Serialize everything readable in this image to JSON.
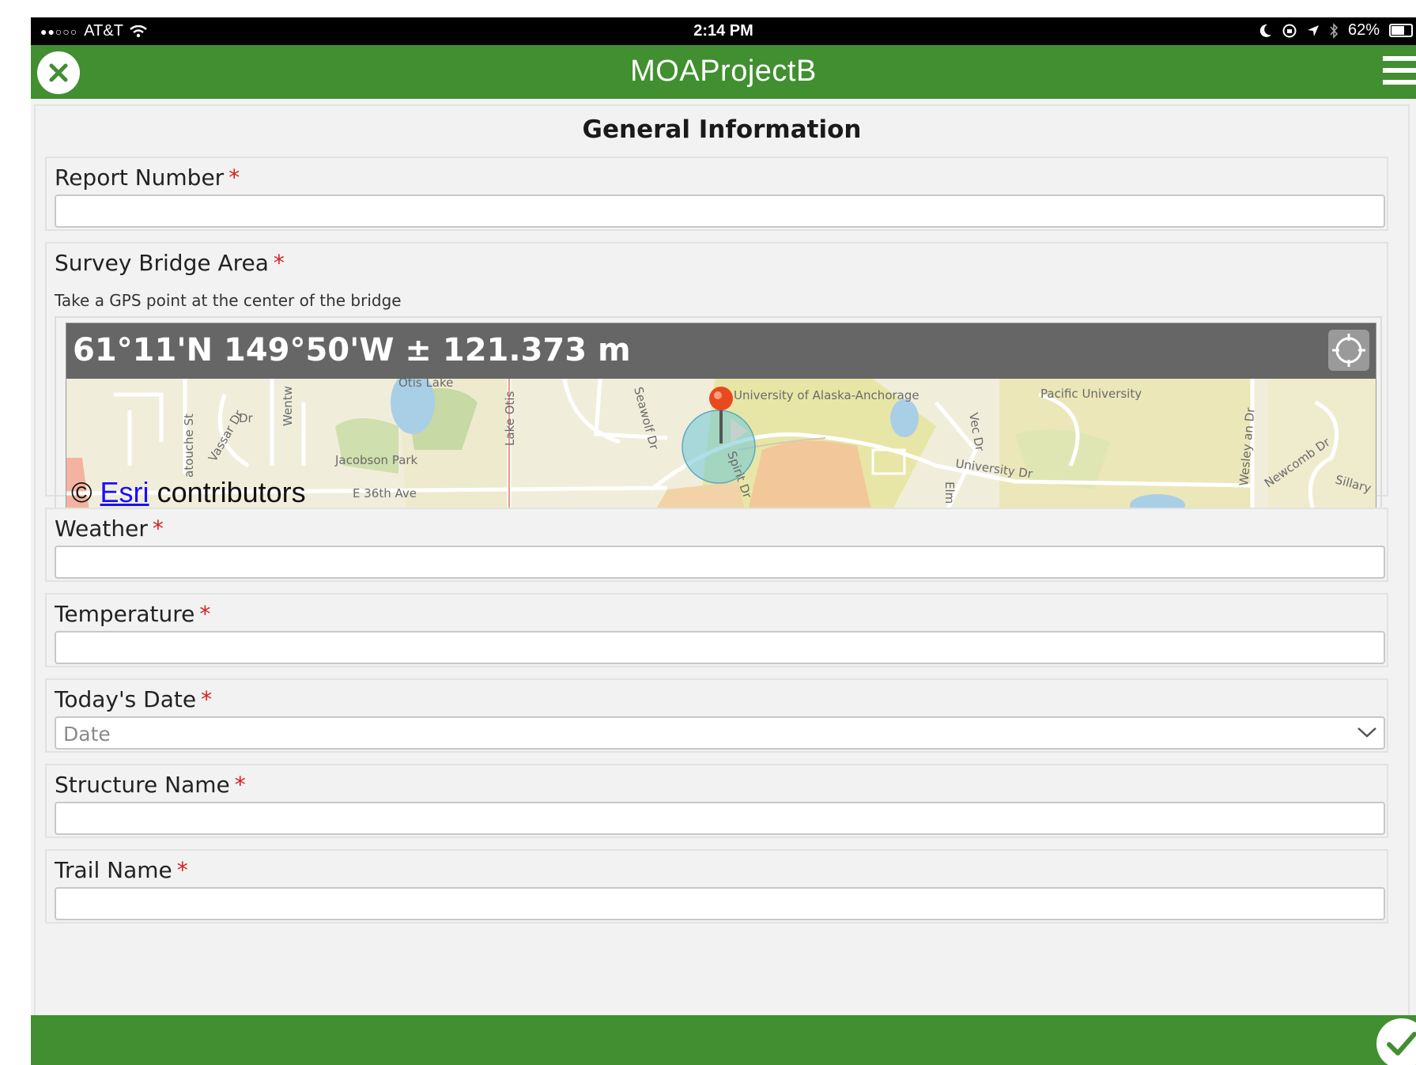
{
  "status_bar": {
    "signal": "●●○○○",
    "carrier": "AT&T",
    "time": "2:14 PM",
    "battery": "62%",
    "battery_level": 0.62
  },
  "header": {
    "title": "MOAProjectB"
  },
  "form": {
    "title": "General Information",
    "required_mark": "*",
    "fields": {
      "report_number": {
        "label": "Report Number",
        "value": ""
      },
      "survey_bridge_area": {
        "label": "Survey Bridge Area",
        "hint": "Take a GPS point at the center of the bridge",
        "coordinates": "61°11'N 149°50'W ± 121.373 m",
        "attribution_prefix": "©",
        "attribution_link": "Esri",
        "attribution_suffix": "contributors",
        "map_labels": [
          "Otis Lake",
          "Lake Otis",
          "Vassar Dr",
          "atouche St",
          "Wentw",
          "Jacobson Park",
          "E 36th Ave",
          "Seawolf Dr",
          "Spirit Dr",
          "University of Alaska-Anchorage",
          "Pacific University",
          "Vec Dr",
          "University Dr",
          "Elm",
          "Wesley an Dr",
          "Newcomb Dr",
          "Sillary",
          "Dr"
        ]
      },
      "weather": {
        "label": "Weather",
        "value": ""
      },
      "temperature": {
        "label": "Temperature",
        "value": ""
      },
      "todays_date": {
        "label": "Today's Date",
        "placeholder": "Date"
      },
      "structure_name": {
        "label": "Structure Name",
        "value": ""
      },
      "trail_name": {
        "label": "Trail Name",
        "value": ""
      }
    }
  },
  "colors": {
    "header_green": "#418f30",
    "required_red": "#d42020",
    "coord_bar": "#666666"
  }
}
